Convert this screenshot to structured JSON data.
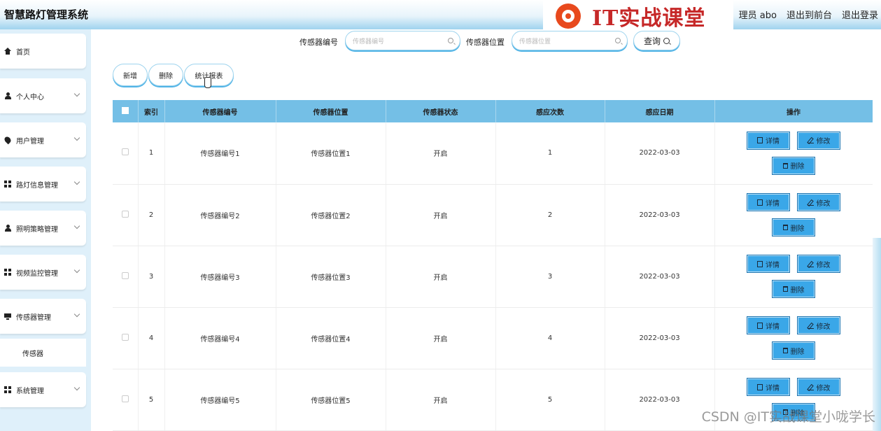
{
  "header": {
    "app_title": "智慧路灯管理系统",
    "user_label": "理员 abo",
    "back_to_front": "退出到前台",
    "logout": "退出登录",
    "watermark_text": "IT实战课堂"
  },
  "sidebar": {
    "items": [
      {
        "label": "首页",
        "icon": "home-icon"
      },
      {
        "label": "个人中心",
        "icon": "user-icon"
      },
      {
        "label": "用户管理",
        "icon": "pin-icon"
      },
      {
        "label": "路灯信息管理",
        "icon": "grid-icon"
      },
      {
        "label": "照明策略管理",
        "icon": "user-icon"
      },
      {
        "label": "视频监控管理",
        "icon": "grid-icon"
      },
      {
        "label": "传感器管理",
        "icon": "monitor-icon"
      },
      {
        "label": "系统管理",
        "icon": "grid-icon"
      }
    ],
    "sub_item": "传感器"
  },
  "search": {
    "sensor_no_label": "传感器编号",
    "sensor_no_placeholder": "传感器编号",
    "sensor_loc_label": "传感器位置",
    "sensor_loc_placeholder": "传感器位置",
    "query_label": "查询"
  },
  "actions": {
    "add": "新增",
    "delete": "删除",
    "report": "统计报表"
  },
  "table": {
    "headers": [
      "索引",
      "传感器编号",
      "传感器位置",
      "传感器状态",
      "感应次数",
      "感应日期",
      "操作"
    ],
    "rows": [
      {
        "index": "1",
        "no": "传感器编号1",
        "loc": "传感器位置1",
        "status": "开启",
        "count": "1",
        "date": "2022-03-03"
      },
      {
        "index": "2",
        "no": "传感器编号2",
        "loc": "传感器位置2",
        "status": "开启",
        "count": "2",
        "date": "2022-03-03"
      },
      {
        "index": "3",
        "no": "传感器编号3",
        "loc": "传感器位置3",
        "status": "开启",
        "count": "3",
        "date": "2022-03-03"
      },
      {
        "index": "4",
        "no": "传感器编号4",
        "loc": "传感器位置4",
        "status": "开启",
        "count": "4",
        "date": "2022-03-03"
      },
      {
        "index": "5",
        "no": "传感器编号5",
        "loc": "传感器位置5",
        "status": "开启",
        "count": "5",
        "date": "2022-03-03"
      }
    ],
    "op_detail": "详情",
    "op_edit": "修改",
    "op_delete": "删除"
  },
  "footer_watermark": "CSDN @IT实战课堂小咙学长",
  "colors": {
    "accent": "#74bfe6",
    "op_button": "#3aa7e8",
    "sidebar_bg": "#dff0fa"
  }
}
